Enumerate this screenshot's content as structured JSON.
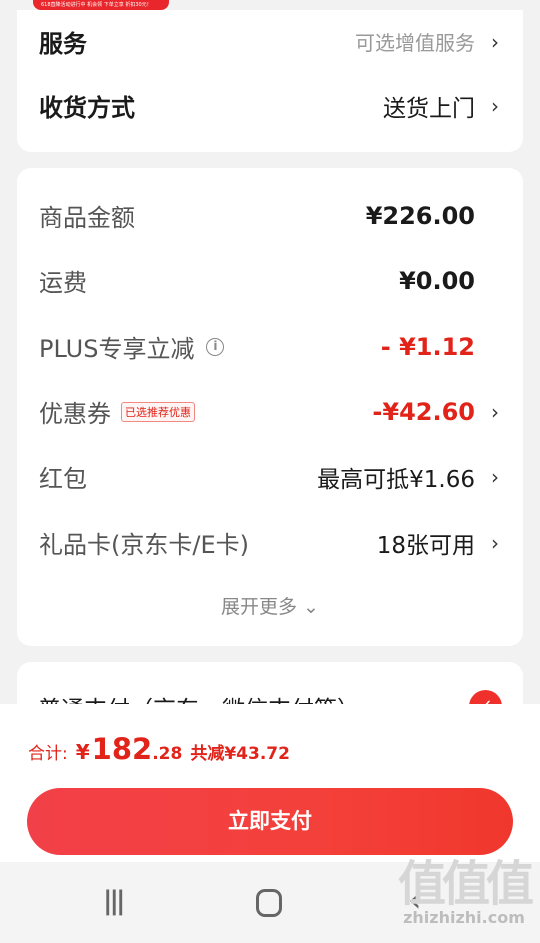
{
  "promo_banner": "618直降活动进行中 机会领 下单立享 折扣30元！",
  "service_card": {
    "service_label": "服务",
    "service_value": "可选增值服务",
    "delivery_label": "收货方式",
    "delivery_value": "送货上门"
  },
  "price_card": {
    "goods_amount_label": "商品金额",
    "goods_amount_value": "¥226.00",
    "shipping_label": "运费",
    "shipping_value": "¥0.00",
    "plus_label": "PLUS专享立减",
    "plus_value": "- ¥1.12",
    "coupon_label": "优惠券",
    "coupon_tag": "已选推荐优惠",
    "coupon_value": "-¥42.60",
    "redpacket_label": "红包",
    "redpacket_value": "最高可抵¥1.66",
    "giftcard_label": "礼品卡(京东卡/E卡)",
    "giftcard_value": "18张可用",
    "expand_label": "展开更多 ⌄"
  },
  "payment": {
    "method_label": "普通支付（京东、微信支付等）",
    "selected": true
  },
  "summary": {
    "total_label": "合计:",
    "currency": "¥",
    "total_int": "182",
    "total_dec": ".28",
    "saved": "共减¥43.72"
  },
  "pay_button_label": "立即支付",
  "watermark": {
    "logo": "值值值",
    "url": "zhizhizhi.com"
  },
  "colors": {
    "accent_red": "#e2231a",
    "button_red": "#f24048"
  }
}
